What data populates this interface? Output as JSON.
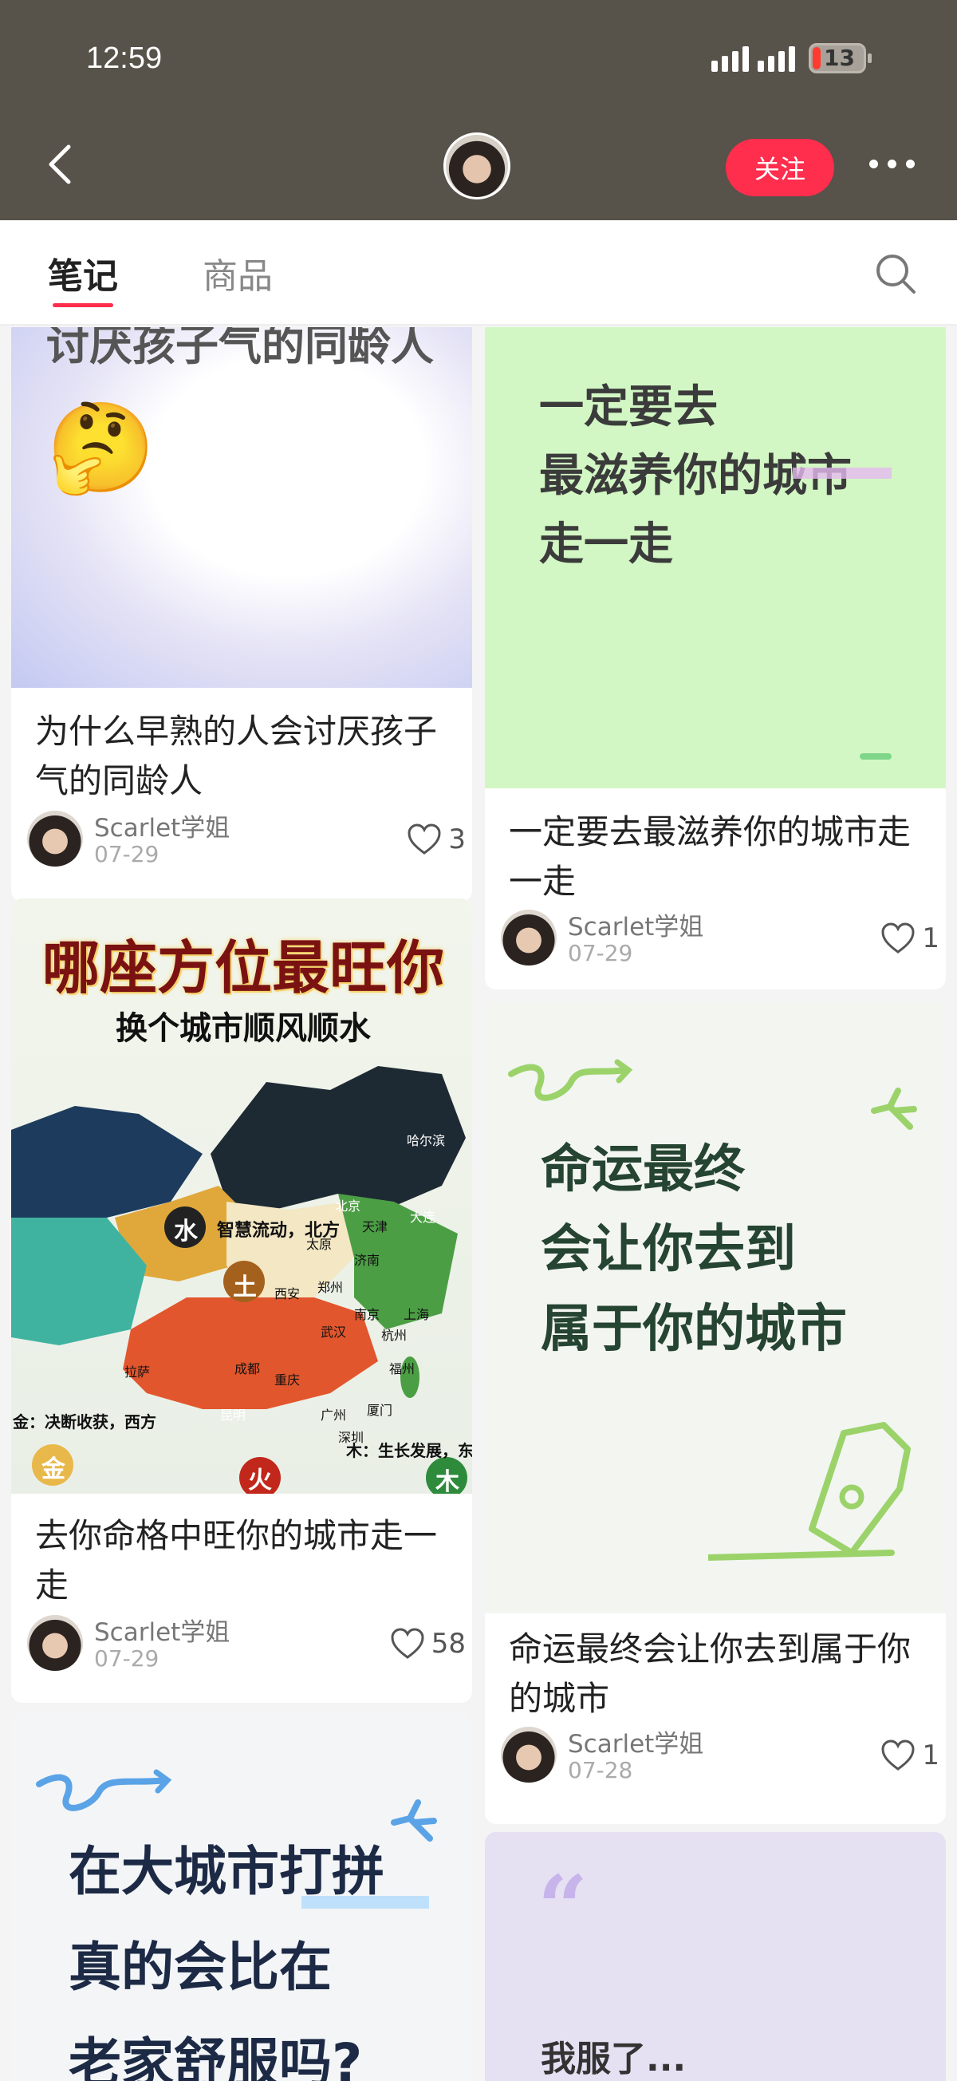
{
  "status_bar": {
    "time": "12:59",
    "battery": "13"
  },
  "nav": {
    "follow_label": "关注"
  },
  "tabs": [
    {
      "label": "笔记"
    },
    {
      "label": "商品"
    }
  ],
  "cards": [
    {
      "title": "为什么早熟的人会讨厌孩子气的同龄人",
      "cover_text_partial": "讨厌孩子气的同龄人",
      "emoji": "🤔",
      "author": "Scarlet学姐",
      "date": "07-29",
      "likes": "3"
    },
    {
      "title": "一定要去最滋养你的城市走一走",
      "cover_lines": [
        "一定要去",
        "最滋养你的城市",
        "走一走"
      ],
      "author": "Scarlet学姐",
      "date": "07-29",
      "likes": "1"
    },
    {
      "title": "去你命格中旺你的城市走一走",
      "cover_heading": "哪座方位最旺你",
      "cover_sub": "换个城市顺风顺水",
      "map_labels": {
        "water": "水",
        "water_desc": "智慧流动，北方",
        "earth": "土",
        "metal": "金",
        "metal_desc": "金：决断收获，西方",
        "wood": "木",
        "wood_desc": "木：生长发展，东方",
        "fire": "火",
        "cities": [
          "哈尔滨",
          "北京",
          "天津",
          "大连",
          "太原",
          "济南",
          "西安",
          "郑州",
          "拉萨",
          "成都",
          "重庆",
          "武汉",
          "南京",
          "上海",
          "杭州",
          "福州",
          "昆明",
          "广州",
          "深圳",
          "厦门"
        ]
      },
      "author": "Scarlet学姐",
      "date": "07-29",
      "likes": "58"
    },
    {
      "title": "命运最终会让你去到属于你的城市",
      "cover_lines": [
        "命运最终",
        "会让你去到",
        "属于你的城市"
      ],
      "author": "Scarlet学姐",
      "date": "07-28",
      "likes": "1"
    },
    {
      "cover_lines": [
        "在大城市打拼",
        "真的会比在",
        "老家舒服吗?"
      ]
    },
    {
      "cover_text": "我服了..."
    }
  ],
  "colors": {
    "accent": "#ff2e4d",
    "header_bg": "#57524a",
    "green_card": "#d2f7c4",
    "lilac_card": "#e6e0f3"
  }
}
